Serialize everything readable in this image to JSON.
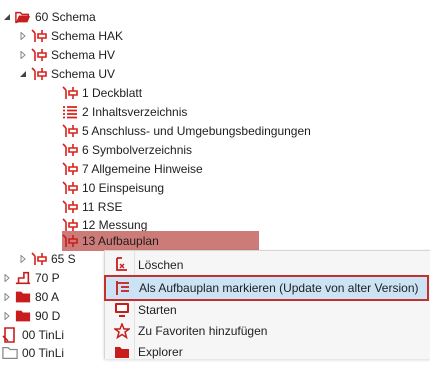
{
  "tree": {
    "root": {
      "label": "60 Schema"
    },
    "hak": {
      "label": "Schema HAK"
    },
    "hv": {
      "label": "Schema HV"
    },
    "uv": {
      "label": "Schema UV"
    },
    "children": [
      {
        "label": "1 Deckblatt",
        "icon": "schema-icon"
      },
      {
        "label": "2 Inhaltsverzeichnis",
        "icon": "list-icon"
      },
      {
        "label": "5 Anschluss- und Umgebungsbedingungen",
        "icon": "schema-icon"
      },
      {
        "label": "6 Symbolverzeichnis",
        "icon": "schema-icon"
      },
      {
        "label": "7 Allgemeine Hinweise",
        "icon": "schema-icon"
      },
      {
        "label": "10 Einspeisung",
        "icon": "schema-icon"
      },
      {
        "label": "11 RSE",
        "icon": "schema-icon"
      },
      {
        "label": "12 Messung",
        "icon": "schema-icon"
      },
      {
        "label": "13 Aufbauplan",
        "icon": "schema-icon",
        "selected": true
      }
    ],
    "truncated": [
      {
        "label": "65 S"
      },
      {
        "label": "70 P"
      },
      {
        "label": "80 A"
      },
      {
        "label": "90 D"
      },
      {
        "label": "00 TinLi"
      },
      {
        "label": "00 TinLi"
      }
    ]
  },
  "context_menu": {
    "items": [
      {
        "label": "Löschen",
        "icon": "delete-icon"
      },
      {
        "label": "Als Aufbauplan markieren (Update von alter Version)",
        "icon": "mark-layout-icon",
        "highlighted": true
      },
      {
        "label": "Starten",
        "icon": "start-icon"
      },
      {
        "label": "Zu Favoriten hinzufügen",
        "icon": "favorite-star-icon"
      },
      {
        "label": "Explorer",
        "icon": "folder-icon"
      }
    ]
  },
  "colors": {
    "selection": "#cd7b78",
    "highlight_fill": "#cce3f5",
    "highlight_border": "#c3312d",
    "schema_icon": "#d9201a",
    "folder_icon": "#c81d1d"
  }
}
